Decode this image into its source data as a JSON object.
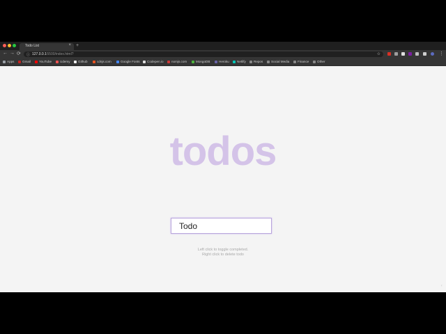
{
  "browser": {
    "tab_title": "Todo List",
    "tab_close": "×",
    "new_tab": "+",
    "url_host": "127.0.0.1",
    "url_path": ":5500/index.html?",
    "lock_glyph": "ⓘ",
    "star_glyph": "☆",
    "nav_back": "←",
    "nav_forward": "→",
    "nav_reload": "⟳",
    "menu_glyph": "⋮",
    "bookmarks": [
      {
        "label": "Apps",
        "icon_color": "#9aa0a6"
      },
      {
        "label": "Gmail",
        "icon_color": "#c5221f"
      },
      {
        "label": "YouTube",
        "icon_color": "#ff0000"
      },
      {
        "label": "Udemy",
        "icon_color": "#ec5252"
      },
      {
        "label": "Github",
        "icon_color": "#eeeeee"
      },
      {
        "label": "cdnjs.com",
        "icon_color": "#e95420"
      },
      {
        "label": "Google Fonts",
        "icon_color": "#4285f4"
      },
      {
        "label": "Codepen.io",
        "icon_color": "#dddddd"
      },
      {
        "label": "nomjs.com",
        "icon_color": "#cb3837"
      },
      {
        "label": "MongoDB",
        "icon_color": "#4db33d"
      },
      {
        "label": "Heroku",
        "icon_color": "#6762a6"
      },
      {
        "label": "Netlify",
        "icon_color": "#00c7b7"
      },
      {
        "label": "Repos",
        "icon_color": "#888888"
      },
      {
        "label": "Social Media",
        "icon_color": "#888888"
      },
      {
        "label": "Finance",
        "icon_color": "#888888"
      },
      {
        "label": "Other",
        "icon_color": "#888888"
      }
    ]
  },
  "app": {
    "heading": "todos",
    "input_value": "Todo",
    "help_line1": "Left click to toggle completed.",
    "help_line2": "Right click to delete todo"
  },
  "colors": {
    "heading": "#d4c3e8",
    "input_border": "#b9a6dc",
    "page_background": "#f4f4f4"
  }
}
